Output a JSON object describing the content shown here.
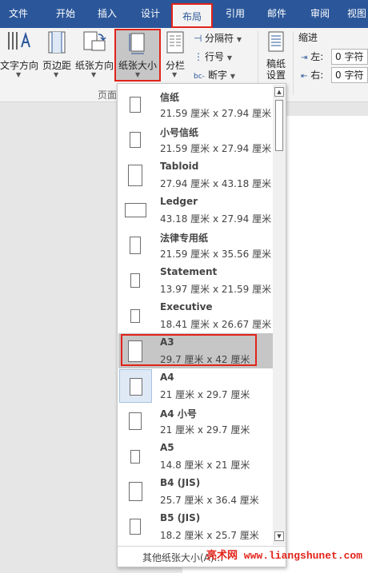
{
  "tabs": [
    {
      "label": "文件",
      "active": false
    },
    {
      "label": "开始",
      "active": false
    },
    {
      "label": "插入",
      "active": false
    },
    {
      "label": "设计",
      "active": false
    },
    {
      "label": "布局",
      "active": true
    },
    {
      "label": "引用",
      "active": false
    },
    {
      "label": "邮件",
      "active": false
    },
    {
      "label": "审阅",
      "active": false
    },
    {
      "label": "视图",
      "active": false
    }
  ],
  "ribbon": {
    "text_direction": "文字方向",
    "margins": "页边距",
    "orientation": "纸张方向",
    "size": "纸张大小",
    "columns": "分栏",
    "breaks": "分隔符",
    "line_numbers": "行号",
    "hyphenation": "断字",
    "draft_settings": "稿纸\n设置",
    "indent_title": "缩进",
    "indent_left_label": "左:",
    "indent_left_value": "0 字符",
    "indent_right_label": "右:",
    "indent_right_value": "0 字符",
    "group_page": "页面"
  },
  "paper_sizes": [
    {
      "name": "信纸",
      "size": "21.59 厘米 x 27.94 厘米",
      "state": "normal"
    },
    {
      "name": "小号信纸",
      "size": "21.59 厘米 x 27.94 厘米",
      "state": "normal"
    },
    {
      "name": "Tabloid",
      "size": "27.94 厘米 x 43.18 厘米",
      "state": "normal"
    },
    {
      "name": "Ledger",
      "size": "43.18 厘米 x 27.94 厘米",
      "state": "normal"
    },
    {
      "name": "法律专用纸",
      "size": "21.59 厘米 x 35.56 厘米",
      "state": "normal"
    },
    {
      "name": "Statement",
      "size": "13.97 厘米 x 21.59 厘米",
      "state": "normal"
    },
    {
      "name": "Executive",
      "size": "18.41 厘米 x 26.67 厘米",
      "state": "normal"
    },
    {
      "name": "A3",
      "size": "29.7 厘米 x 42 厘米",
      "state": "selected"
    },
    {
      "name": "A4",
      "size": "21 厘米 x 29.7 厘米",
      "state": "current"
    },
    {
      "name": "A4 小号",
      "size": "21 厘米 x 29.7 厘米",
      "state": "normal"
    },
    {
      "name": "A5",
      "size": "14.8 厘米 x 21 厘米",
      "state": "normal"
    },
    {
      "name": "B4 (JIS)",
      "size": "25.7 厘米 x 36.4 厘米",
      "state": "normal"
    },
    {
      "name": "B5 (JIS)",
      "size": "18.2 厘米 x 25.7 厘米",
      "state": "normal"
    }
  ],
  "more_sizes": "其他纸张大小(A)...",
  "watermark": "亮术网 www.liangshunet.com",
  "colors": {
    "accent": "#2b579a",
    "highlight": "#e2231a",
    "selected_bg": "#c6c6c6"
  }
}
